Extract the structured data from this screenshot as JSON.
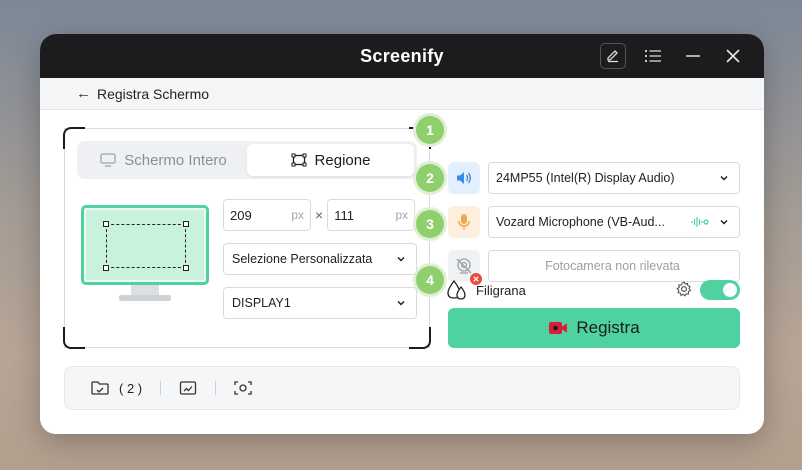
{
  "app": {
    "title": "Screenify"
  },
  "breadcrumb": {
    "label": "Registra Schermo"
  },
  "capture": {
    "tabs": [
      {
        "label": "Schermo Intero",
        "active": false
      },
      {
        "label": "Regione",
        "active": true
      }
    ],
    "width": {
      "value": "209",
      "unit": "px"
    },
    "height": {
      "value": "111",
      "unit": "px"
    },
    "separator": "×",
    "selection_mode": "Selezione Personalizzata",
    "display": "DISPLAY1"
  },
  "devices": {
    "steps": [
      "1",
      "2",
      "3",
      "4"
    ],
    "speaker": "24MP55 (Intel(R) Display Audio)",
    "microphone": "Vozard Microphone (VB-Aud...",
    "camera": "Fotocamera non rilevata"
  },
  "watermark": {
    "label": "Filigrana",
    "enabled": true
  },
  "record": {
    "label": "Registra"
  },
  "bottom": {
    "folder_count": "( 2 )"
  },
  "colors": {
    "accent": "#4fd1a0",
    "step": "#8fcf6e",
    "titlebar": "#1c1c1e",
    "speaker_bg": "#e3effc",
    "mic_bg": "#fdeedd"
  }
}
